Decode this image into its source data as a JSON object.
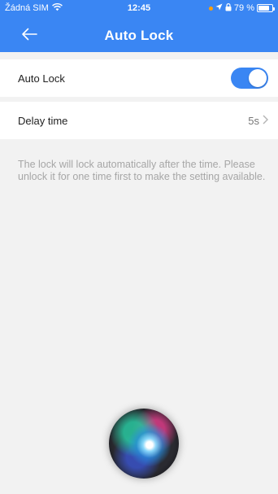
{
  "status_bar": {
    "carrier": "Žádná SIM",
    "time": "12:45",
    "battery": "79 %",
    "battery_level": 0.79
  },
  "header": {
    "title": "Auto Lock"
  },
  "settings": {
    "auto_lock": {
      "label": "Auto Lock",
      "enabled": true
    },
    "delay_time": {
      "label": "Delay time",
      "value": "5s"
    }
  },
  "hint": "The lock will lock automatically after the time. Please unlock it for one time first to make the setting available.",
  "colors": {
    "accent": "#3a86f3",
    "background": "#f2f2f2",
    "hint_text": "#a6a6a6"
  },
  "icons": [
    "wifi-icon",
    "location-icon",
    "lock-rotation-icon",
    "battery-icon",
    "back-arrow-icon",
    "chevron-right-icon",
    "siri-icon"
  ]
}
